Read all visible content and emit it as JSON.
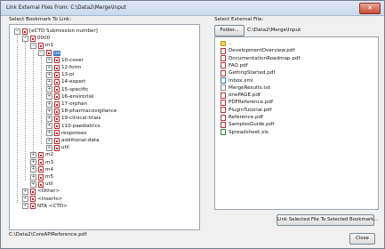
{
  "window": {
    "title": "Link External Files From: C:\\Data2\\Merge\\Input",
    "close_glyph": "✕"
  },
  "left": {
    "label": "Select Bookmark To Link:",
    "footer_path": "C:\\Data2\\CoreAPIReference.pdf"
  },
  "tree": [
    {
      "label": "[eCTD Submission number]",
      "pm": "−"
    },
    {
      "label": "0000",
      "pm": "−"
    },
    {
      "label": "m1",
      "pm": "−"
    },
    {
      "label": "us",
      "pm": "−",
      "selected": true
    },
    {
      "label": "10-cover",
      "pm": "+"
    },
    {
      "label": "12-form",
      "pm": "+"
    },
    {
      "label": "13-pi",
      "pm": "+"
    },
    {
      "label": "14-expert",
      "pm": "+"
    },
    {
      "label": "15-specific",
      "pm": "+"
    },
    {
      "label": "16-envirorisk",
      "pm": "+"
    },
    {
      "label": "17-orphan",
      "pm": "+"
    },
    {
      "label": "18-pharmacovigilance",
      "pm": "+"
    },
    {
      "label": "19-clinical-trials",
      "pm": "+"
    },
    {
      "label": "110-paediatrics",
      "pm": "+"
    },
    {
      "label": "responses",
      "pm": "+"
    },
    {
      "label": "additional-data",
      "pm": "+"
    },
    {
      "label": "util",
      "pm": "+"
    },
    {
      "label": "m2",
      "pm": "+"
    },
    {
      "label": "m3",
      "pm": "+"
    },
    {
      "label": "m4",
      "pm": "+"
    },
    {
      "label": "m5",
      "pm": "+"
    },
    {
      "label": "util",
      "pm": "+"
    },
    {
      "label": "<Other>",
      "pm": "+"
    },
    {
      "label": "<Inserts>",
      "pm": "+"
    },
    {
      "label": "NTA <CTD>",
      "pm": "+"
    }
  ],
  "right": {
    "label": "Select External File:",
    "folder_button": "Folder...",
    "folder_path": "C:\\Data2\\Merge\\Input",
    "files": [
      {
        "name": "..",
        "type": "folder"
      },
      {
        "name": "DevelopmentOverview.pdf",
        "type": "pdf"
      },
      {
        "name": "DocumentationRoadmap.pdf",
        "type": "pdf"
      },
      {
        "name": "FAQ.pdf",
        "type": "pdf"
      },
      {
        "name": "GettingStarted.pdf",
        "type": "pdf"
      },
      {
        "name": "Inbox.xml",
        "type": "xml"
      },
      {
        "name": "MergeResults.txt",
        "type": "txt"
      },
      {
        "name": "onePAGE.pdf",
        "type": "pdf"
      },
      {
        "name": "PDFReference.pdf",
        "type": "pdf"
      },
      {
        "name": "PluginTutorial.pdf",
        "type": "pdf"
      },
      {
        "name": "Reference.pdf",
        "type": "pdf"
      },
      {
        "name": "SamplesGuide.pdf",
        "type": "pdf"
      },
      {
        "name": "Spreadsheet.xls",
        "type": "xls"
      }
    ],
    "link_button": "Link Selected File To Selected Bookmark..."
  },
  "footer": {
    "close_button": "Close"
  }
}
